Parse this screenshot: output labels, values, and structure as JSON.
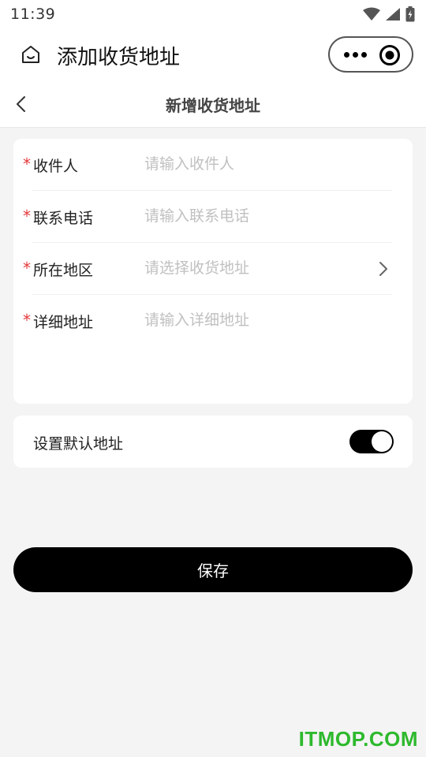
{
  "status_bar": {
    "time": "11:39",
    "icons": [
      "wifi-icon",
      "signal-icon",
      "battery-icon"
    ]
  },
  "nav": {
    "title": "添加收货地址",
    "home_icon": "home-icon",
    "more_icon": "more-dots-icon",
    "target_icon": "target-icon"
  },
  "sub_header": {
    "title": "新增收货地址",
    "back_icon": "chevron-left-icon"
  },
  "form": {
    "required_mark": "*",
    "fields": [
      {
        "label": "收件人",
        "placeholder": "请输入收件人",
        "value": ""
      },
      {
        "label": "联系电话",
        "placeholder": "请输入联系电话",
        "value": ""
      },
      {
        "label": "所在地区",
        "placeholder": "请选择收货地址",
        "value": ""
      },
      {
        "label": "详细地址",
        "placeholder": "请输入详细地址",
        "value": ""
      }
    ]
  },
  "default_setting": {
    "label": "设置默认地址",
    "enabled": true
  },
  "save": {
    "label": "保存"
  },
  "watermark": "ITMOP.COM",
  "colors": {
    "background": "#f4f4f4",
    "card": "#ffffff",
    "accent": "#000000",
    "required": "#e4393c",
    "placeholder": "#c0c0c0",
    "watermark": "#2db92d"
  }
}
